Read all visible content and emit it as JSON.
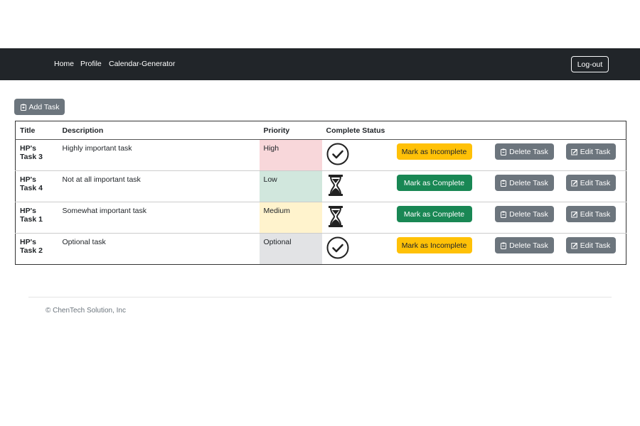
{
  "nav": {
    "home": "Home",
    "profile": "Profile",
    "calendar": "Calendar-Generator",
    "logout": "Log-out"
  },
  "add_task": "Add Task",
  "table": {
    "headers": [
      "Title",
      "Description",
      "Priority",
      "Complete Status"
    ],
    "rows": [
      {
        "title": "HP's Task 3",
        "description": "Highly important task",
        "priority": "High",
        "priority_color": "#f8d7da",
        "status": "complete",
        "status_icon": "check-circle-icon",
        "toggle": "Mark as Incomplete"
      },
      {
        "title": "HP's Task 4",
        "description": "Not at all important task",
        "priority": "Low",
        "priority_color": "#d1e7dd",
        "status": "incomplete",
        "status_icon": "hourglass-icon",
        "toggle": "Mark as Complete"
      },
      {
        "title": "HP's Task 1",
        "description": "Somewhat important task",
        "priority": "Medium",
        "priority_color": "#fff3cd",
        "status": "incomplete",
        "status_icon": "hourglass-icon",
        "toggle": "Mark as Complete"
      },
      {
        "title": "HP's Task 2",
        "description": "Optional task",
        "priority": "Optional",
        "priority_color": "#e2e3e5",
        "status": "complete",
        "status_icon": "check-circle-icon",
        "toggle": "Mark as Incomplete"
      }
    ],
    "delete_label": "Delete Task",
    "edit_label": "Edit Task"
  },
  "footer": "© ChenTech Solution, Inc"
}
